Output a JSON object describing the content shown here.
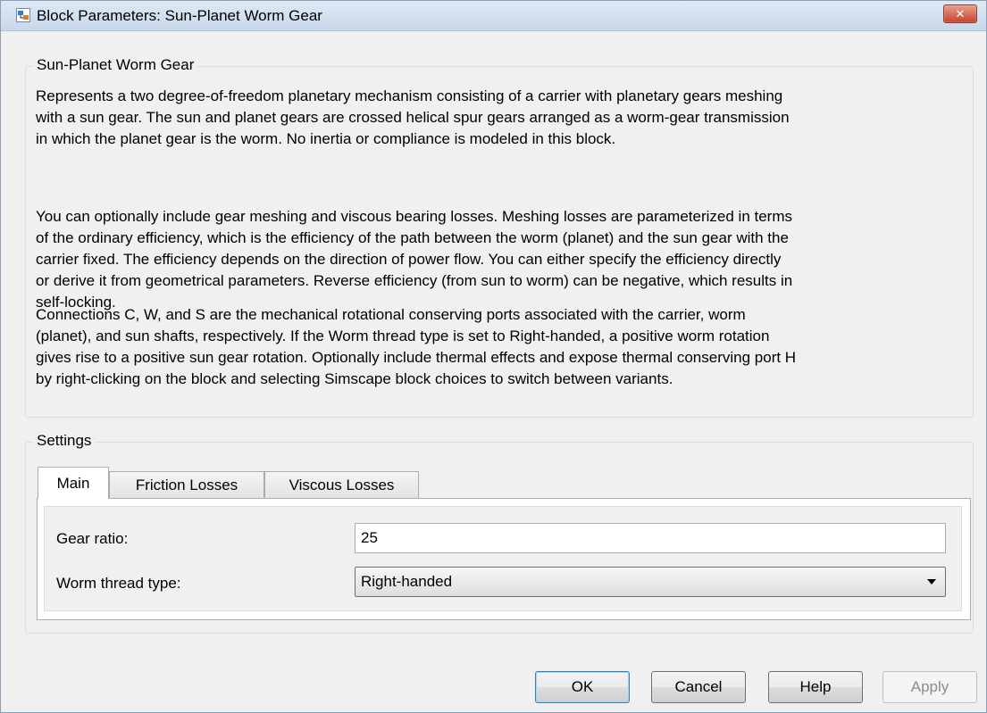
{
  "window": {
    "title": "Block Parameters: Sun-Planet Worm Gear",
    "close_label": "✕"
  },
  "description": {
    "group_title": "Sun-Planet Worm Gear",
    "paragraphs": [
      [
        "Represents a two degree-of-freedom planetary mechanism consisting of a carrier with planetary gears meshing",
        "with a sun gear. The sun and planet gears are crossed helical spur gears arranged as a worm-gear transmission",
        "in which the planet gear is the worm. No inertia or compliance is modeled in this block."
      ],
      [
        "You can optionally include gear meshing and viscous bearing losses. Meshing losses are parameterized in terms",
        "of the ordinary efficiency, which is the efficiency of the path between the worm (planet) and the sun gear with the",
        "carrier fixed. The efficiency depends on the direction of power flow. You can either specify the efficiency directly",
        "or derive it from geometrical parameters. Reverse efficiency (from sun to worm) can be negative, which results in",
        "self-locking."
      ],
      [
        "Connections C, W, and S are the mechanical rotational conserving ports associated with the carrier, worm",
        "(planet), and sun shafts, respectively. If the Worm thread type is set to Right-handed, a positive worm rotation",
        "gives rise to a positive sun gear rotation. Optionally include thermal effects and expose thermal conserving port H",
        "by right-clicking on the block and selecting Simscape block choices to switch between variants."
      ]
    ]
  },
  "settings": {
    "group_title": "Settings",
    "tabs": [
      "Main",
      "Friction Losses",
      "Viscous Losses"
    ],
    "active_tab": "Main",
    "gear_ratio": {
      "label": "Gear ratio:",
      "value": "25"
    },
    "worm_thread_type": {
      "label": "Worm thread type:",
      "value": "Right-handed"
    }
  },
  "buttons": {
    "ok": "OK",
    "cancel": "Cancel",
    "help": "Help",
    "apply": "Apply"
  }
}
